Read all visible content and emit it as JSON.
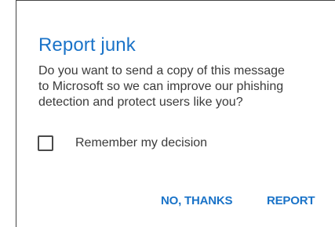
{
  "dialog": {
    "title": "Report junk",
    "message_lines": [
      "Do you want to send a copy of this message",
      "to Microsoft so we can improve our phishing",
      "detection and protect users like you?"
    ],
    "checkbox": {
      "label": "Remember my decision",
      "checked": false
    },
    "buttons": {
      "negative": "NO, THANKS",
      "positive": "REPORT"
    }
  },
  "colors": {
    "accent": "#1a73c8",
    "text": "#3a3a3a",
    "background": "#ffffff"
  }
}
